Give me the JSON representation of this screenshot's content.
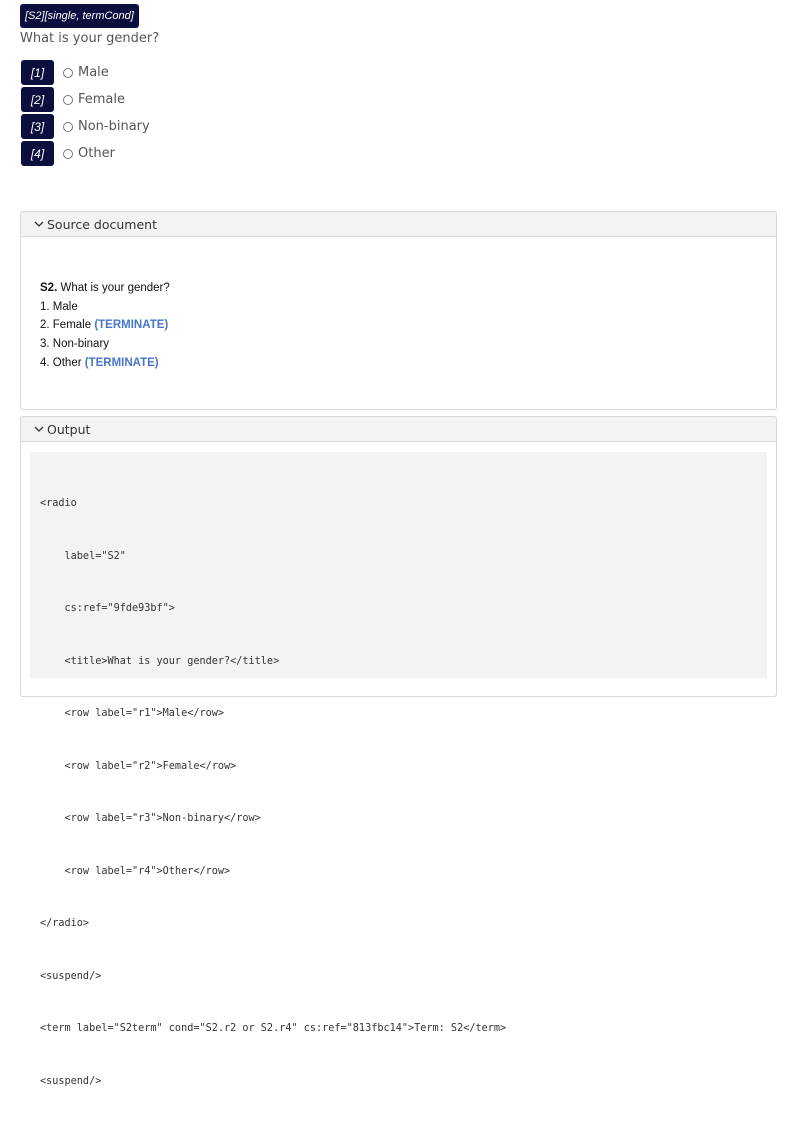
{
  "question_tag": "[S2][single, termCond]",
  "question_text": "What is your gender?",
  "options": [
    {
      "number": "[1]",
      "label": "Male"
    },
    {
      "number": "[2]",
      "label": "Female"
    },
    {
      "number": "[3]",
      "label": "Non-binary"
    },
    {
      "number": "[4]",
      "label": "Other"
    }
  ],
  "source_panel": {
    "title": "Source document",
    "question_id": "S2.",
    "question_text": " What is your gender?",
    "items": [
      {
        "text": "1. Male",
        "flag": ""
      },
      {
        "text": "2. Female ",
        "flag": "(TERMINATE)"
      },
      {
        "text": "3. Non-binary",
        "flag": ""
      },
      {
        "text": "4. Other ",
        "flag": "(TERMINATE)"
      }
    ]
  },
  "output_panel": {
    "title": "Output",
    "code_lines": [
      "<radio",
      "    label=\"S2\"",
      "    cs:ref=\"9fde93bf\">",
      "    <title>What is your gender?</title>",
      "    <row label=\"r1\">Male</row>",
      "    <row label=\"r2\">Female</row>",
      "    <row label=\"r3\">Non-binary</row>",
      "    <row label=\"r4\">Other</row>",
      "</radio>",
      "<suspend/>",
      "<term label=\"S2term\" cond=\"S2.r2 or S2.r4\" cs:ref=\"813fbc14\">Term: S2</term>",
      "<suspend/>"
    ]
  },
  "colors": {
    "tag_bg": "#0c0f3d",
    "terminate": "#4a76c9"
  },
  "icons": {
    "panel_toggle": "chevron-down-icon",
    "option_control": "radio-button-icon"
  }
}
